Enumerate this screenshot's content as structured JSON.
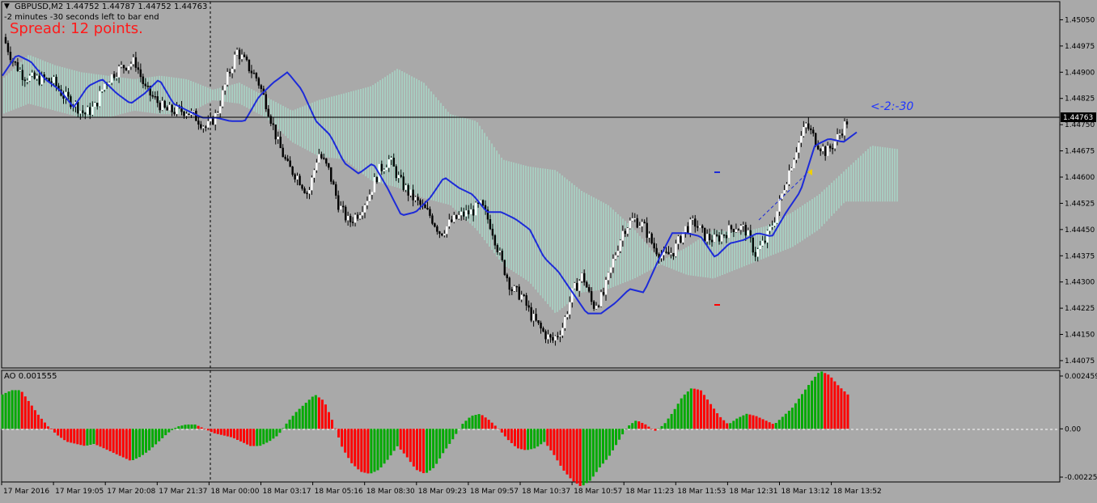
{
  "header": {
    "menu_icon": "triangle-down-icon",
    "symbol_info": "GBPUSD,M2  1.44752 1.44787 1.44752 1.44763",
    "timer_text": "-2 minutes -30 seconds left to bar end",
    "spread_text": "Spread: 12 points.",
    "countdown_label": "<-2:-30"
  },
  "colors": {
    "background": "#a9a9a9",
    "bull_candle": "#ffffff",
    "bear_candle": "#000000",
    "ma_line": "#1d2bd8",
    "cloud_bull": "#a8f0d8",
    "cloud_bear": "#f4f0dc",
    "ao_up": "#00aa00",
    "ao_down": "#ff0000",
    "countdown": "#1f34ff",
    "spread": "#ff1a1a"
  },
  "chart_data": [
    {
      "type": "candlestick",
      "symbol": "GBPUSD",
      "timeframe": "M2",
      "current_price": 1.44763,
      "ylim": [
        1.44061,
        1.45095
      ],
      "y_ticks": [
        "1.45050",
        "1.44975",
        "1.44900",
        "1.44825",
        "1.44763",
        "1.44750",
        "1.44675",
        "1.44600",
        "1.44525",
        "1.44450",
        "1.44375",
        "1.44300",
        "1.44225",
        "1.44150",
        "1.44075"
      ],
      "x_ticks": [
        "17 Mar 2016",
        "17 Mar 19:05",
        "17 Mar 20:08",
        "17 Mar 21:37",
        "18 Mar 00:00",
        "18 Mar 03:17",
        "18 Mar 05:16",
        "18 Mar 08:30",
        "18 Mar 09:23",
        "18 Mar 09:57",
        "18 Mar 10:37",
        "18 Mar 10:57",
        "18 Mar 11:23",
        "18 Mar 11:53",
        "18 Mar 12:31",
        "18 Mar 13:12",
        "18 Mar 13:52"
      ],
      "close_path": [
        1.45,
        1.4493,
        1.4489,
        1.4488,
        1.4488,
        1.4487,
        1.4483,
        1.4481,
        1.4478,
        1.448,
        1.4487,
        1.449,
        1.4492,
        1.4493,
        1.4485,
        1.4482,
        1.4479,
        1.4479,
        1.4479,
        1.4477,
        1.4474,
        1.4478,
        1.4488,
        1.4496,
        1.4492,
        1.4488,
        1.448,
        1.447,
        1.4463,
        1.446,
        1.4455,
        1.4467,
        1.4462,
        1.4452,
        1.4447,
        1.445,
        1.4455,
        1.4462,
        1.4465,
        1.4459,
        1.4455,
        1.4452,
        1.4449,
        1.4444,
        1.4447,
        1.4449,
        1.445,
        1.4452,
        1.4446,
        1.4436,
        1.4428,
        1.4426,
        1.442,
        1.4416,
        1.4413,
        1.4417,
        1.4427,
        1.4432,
        1.4423,
        1.4426,
        1.4436,
        1.4445,
        1.4448,
        1.4446,
        1.444,
        1.4437,
        1.4439,
        1.4445,
        1.4447,
        1.4443,
        1.4442,
        1.4444,
        1.4446,
        1.4445,
        1.4438,
        1.4442,
        1.4449,
        1.4459,
        1.4468,
        1.4475,
        1.447,
        1.4467,
        1.4471,
        1.4476
      ],
      "ma_line": [
        1.4489,
        1.4495,
        1.4493,
        1.4488,
        1.4485,
        1.448,
        1.4486,
        1.4488,
        1.4484,
        1.4481,
        1.4484,
        1.4488,
        1.4481,
        1.4479,
        1.4477,
        1.4477,
        1.4476,
        1.4476,
        1.4483,
        1.4487,
        1.449,
        1.4485,
        1.4476,
        1.4472,
        1.4464,
        1.4461,
        1.4464,
        1.4457,
        1.4449,
        1.445,
        1.4454,
        1.446,
        1.4457,
        1.4455,
        1.445,
        1.445,
        1.4448,
        1.4445,
        1.4437,
        1.4433,
        1.4427,
        1.4421,
        1.4421,
        1.4424,
        1.4428,
        1.4427,
        1.4436,
        1.4444,
        1.4444,
        1.4443,
        1.4437,
        1.4441,
        1.4442,
        1.4444,
        1.4443,
        1.445,
        1.4456,
        1.4469,
        1.4471,
        1.447,
        1.4473
      ],
      "cloud_top": [
        1.4488,
        1.4495,
        1.4492,
        1.449,
        1.4489,
        1.4488,
        1.4489,
        1.4488,
        1.4485,
        1.4487,
        1.4483,
        1.4479,
        1.4482,
        1.4484,
        1.4486,
        1.4491,
        1.4487,
        1.4478,
        1.4476,
        1.4465,
        1.4463,
        1.4462,
        1.4456,
        1.4452,
        1.4445,
        1.4436,
        1.444,
        1.4445,
        1.4444,
        1.4446,
        1.445,
        1.4455,
        1.4462,
        1.4469,
        1.4468
      ],
      "cloud_bottom": [
        1.4478,
        1.4481,
        1.4479,
        1.4477,
        1.4477,
        1.4479,
        1.4478,
        1.4478,
        1.4482,
        1.4481,
        1.4477,
        1.447,
        1.4466,
        1.4465,
        1.4459,
        1.4457,
        1.4454,
        1.4452,
        1.4445,
        1.4435,
        1.443,
        1.4421,
        1.4427,
        1.4428,
        1.4431,
        1.4435,
        1.4432,
        1.4431,
        1.4434,
        1.4437,
        1.444,
        1.4445,
        1.4453,
        1.4453,
        1.4453
      ]
    },
    {
      "type": "bar",
      "indicator": "AO",
      "current_value": 0.001555,
      "ylim": [
        -0.00225,
        0.002459
      ],
      "y_ticks": [
        "0.002459",
        "0.00",
        "-0.00225"
      ],
      "values": [
        0.0016,
        0.0018,
        0.0018,
        0.0012,
        0.0006,
        0.0001,
        -0.0003,
        -0.0006,
        -0.0007,
        -0.0008,
        -0.0007,
        -0.0009,
        -0.0011,
        -0.0013,
        -0.0015,
        -0.0013,
        -0.001,
        -0.0006,
        -0.0002,
        0.0001,
        0.0002,
        0.0002,
        0.0,
        -0.0002,
        -0.0003,
        -0.0004,
        -0.0006,
        -0.0008,
        -0.0008,
        -0.0006,
        -0.0003,
        0.0003,
        0.0008,
        0.0012,
        0.0016,
        0.0013,
        0.0003,
        -0.0009,
        -0.0016,
        -0.002,
        -0.0021,
        -0.0019,
        -0.0014,
        -0.0008,
        -0.0013,
        -0.0019,
        -0.0021,
        -0.0018,
        -0.0011,
        -0.0005,
        0.0002,
        0.0006,
        0.0007,
        0.0004,
        0.0,
        -0.0005,
        -0.0009,
        -0.001,
        -0.0009,
        -0.0006,
        -0.0012,
        -0.0019,
        -0.0024,
        -0.0027,
        -0.0024,
        -0.0018,
        -0.0013,
        -0.0006,
        0.0001,
        0.0004,
        0.0002,
        -0.0001,
        0.0002,
        0.0008,
        0.0015,
        0.0019,
        0.0018,
        0.0012,
        0.0006,
        0.0002,
        0.0005,
        0.0007,
        0.0006,
        0.0004,
        0.0002,
        0.0006,
        0.001,
        0.0016,
        0.0022,
        0.0027,
        0.0025,
        0.002,
        0.0016
      ]
    }
  ]
}
